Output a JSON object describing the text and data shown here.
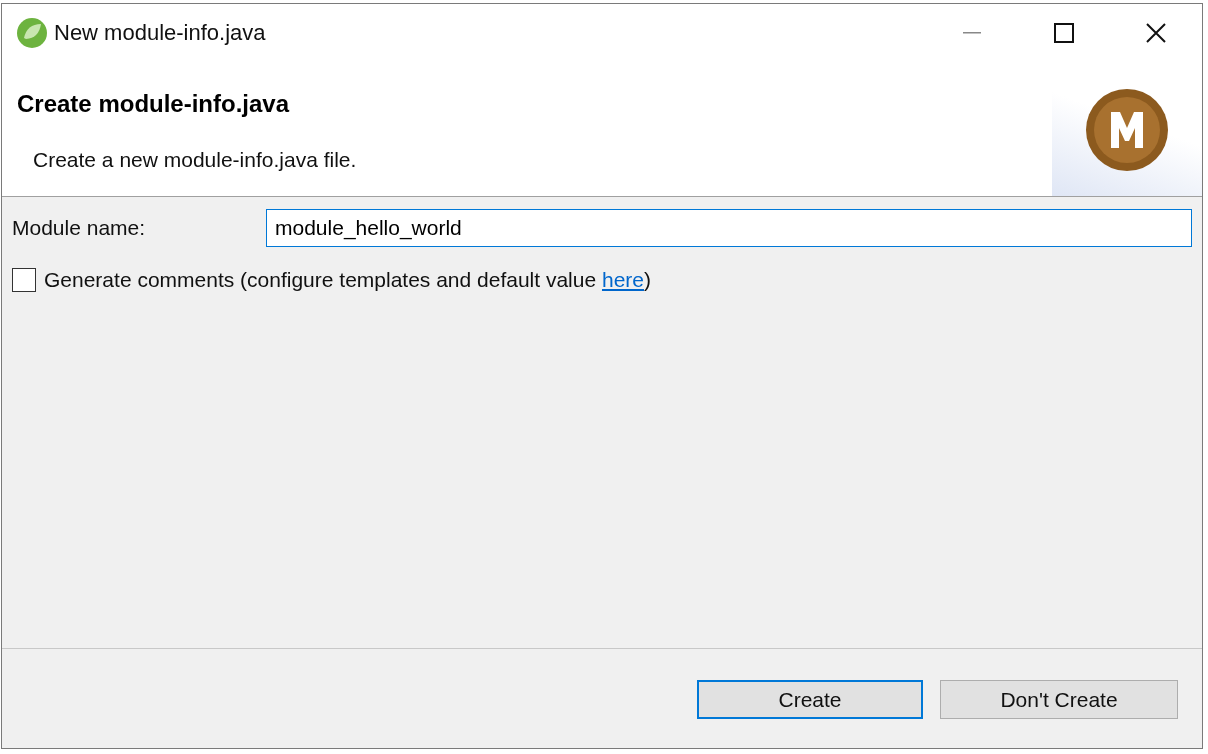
{
  "window": {
    "title": "New module-info.java"
  },
  "banner": {
    "title": "Create module-info.java",
    "description": "Create a new module-info.java file."
  },
  "form": {
    "module_name": {
      "label": "Module name:",
      "value": "module_hello_world"
    },
    "generate_comments": {
      "checked": false,
      "text_before": "Generate comments (configure templates and default value ",
      "link": "here",
      "text_after": ")"
    }
  },
  "buttons": [
    {
      "label": "Create",
      "default": true
    },
    {
      "label": "Don't Create",
      "default": false
    }
  ]
}
